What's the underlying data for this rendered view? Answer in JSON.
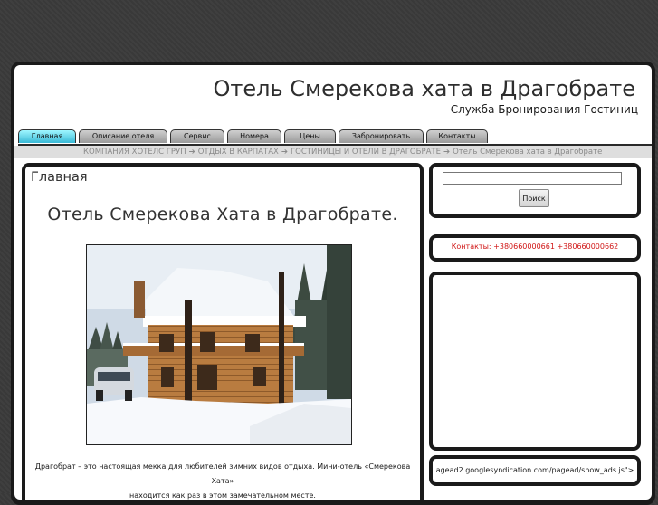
{
  "header": {
    "title": "Отель Смерекова хата в Драгобрате",
    "subtitle": "Служба Бронирования Гостиниц"
  },
  "nav": {
    "tabs": [
      {
        "label": "Главная",
        "active": true
      },
      {
        "label": "Описание отеля",
        "active": false
      },
      {
        "label": "Сервис",
        "active": false
      },
      {
        "label": "Номера",
        "active": false
      },
      {
        "label": "Цены",
        "active": false
      },
      {
        "label": "Забронировать",
        "active": false
      },
      {
        "label": "Контакты",
        "active": false
      }
    ]
  },
  "breadcrumb": {
    "items": [
      "КОМПАНИЯ ХОТЕЛС ГРУП",
      "ОТДЫХ В КАРПАТАХ",
      "ГОСТИНИЦЫ И ОТЕЛИ В ДРАГОБРАТЕ",
      "Отель Смерекова хата в Драгобрате"
    ],
    "separator": "➔"
  },
  "main": {
    "heading": "Главная",
    "article_title": "Отель Смерекова Хата в Драгобрате.",
    "caption_line1": "Драгобрат – это настоящая мекка для любителей зимних видов отдыха. Мини-отель «Смерекова Хата»",
    "caption_line2": "находится как раз в этом замечательном месте."
  },
  "sidebar": {
    "search": {
      "value": "",
      "placeholder": "",
      "button_label": "Поиск"
    },
    "contacts": "Контакты: +380660000661 +380660000662",
    "ad_text": "agead2.googlesyndication.com/pagead/show_ads.js\">"
  },
  "colors": {
    "page_background": "#3a3a3a",
    "active_tab": "#38b9d6",
    "contacts_text": "#d01515"
  }
}
